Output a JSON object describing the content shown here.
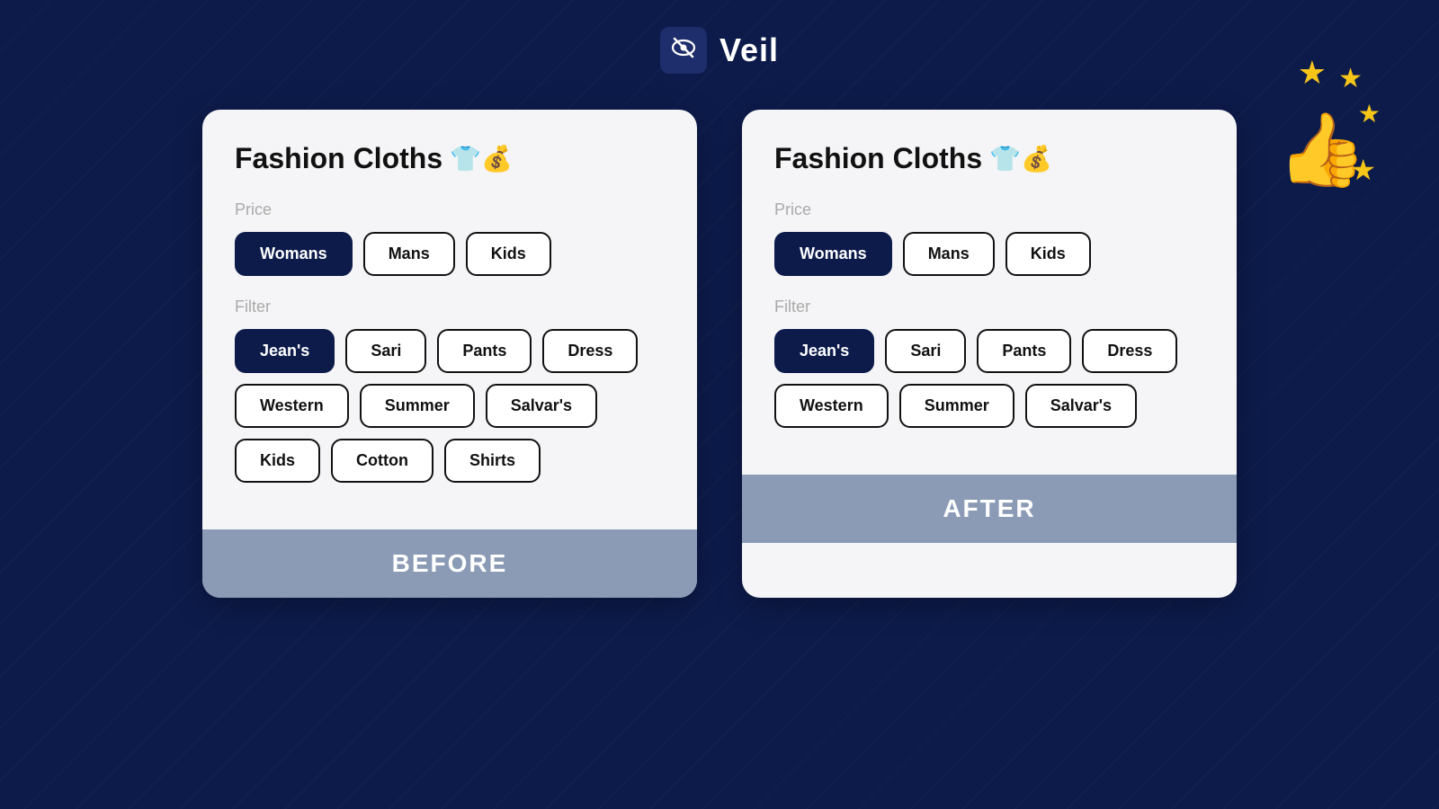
{
  "app": {
    "logo_text": "Veil",
    "logo_icon": "👁️"
  },
  "decoration": {
    "thumb": "👍",
    "stars": [
      "★",
      "★",
      "★",
      "★",
      "★"
    ]
  },
  "before": {
    "footer_label": "BEFORE",
    "title": "Fashion Cloths",
    "title_emoji": "👕",
    "price_label": "Price",
    "filter_label": "Filter",
    "price_buttons": [
      {
        "label": "Womans",
        "active": true
      },
      {
        "label": "Mans",
        "active": false
      },
      {
        "label": "Kids",
        "active": false
      }
    ],
    "filter_buttons": [
      {
        "label": "Jean's",
        "active": true
      },
      {
        "label": "Sari",
        "active": false
      },
      {
        "label": "Pants",
        "active": false
      },
      {
        "label": "Dress",
        "active": false
      },
      {
        "label": "Western",
        "active": false
      },
      {
        "label": "Summer",
        "active": false
      },
      {
        "label": "Salvar's",
        "active": false
      },
      {
        "label": "Kids",
        "active": false
      },
      {
        "label": "Cotton",
        "active": false
      },
      {
        "label": "Shirts",
        "active": false
      }
    ]
  },
  "after": {
    "footer_label": "AFTER",
    "title": "Fashion Cloths",
    "title_emoji": "👕",
    "price_label": "Price",
    "filter_label": "Filter",
    "price_buttons": [
      {
        "label": "Womans",
        "active": true
      },
      {
        "label": "Mans",
        "active": false
      },
      {
        "label": "Kids",
        "active": false
      }
    ],
    "filter_buttons": [
      {
        "label": "Jean's",
        "active": true
      },
      {
        "label": "Sari",
        "active": false
      },
      {
        "label": "Pants",
        "active": false
      },
      {
        "label": "Dress",
        "active": false
      },
      {
        "label": "Western",
        "active": false
      },
      {
        "label": "Summer",
        "active": false
      },
      {
        "label": "Salvar's",
        "active": false
      }
    ]
  }
}
